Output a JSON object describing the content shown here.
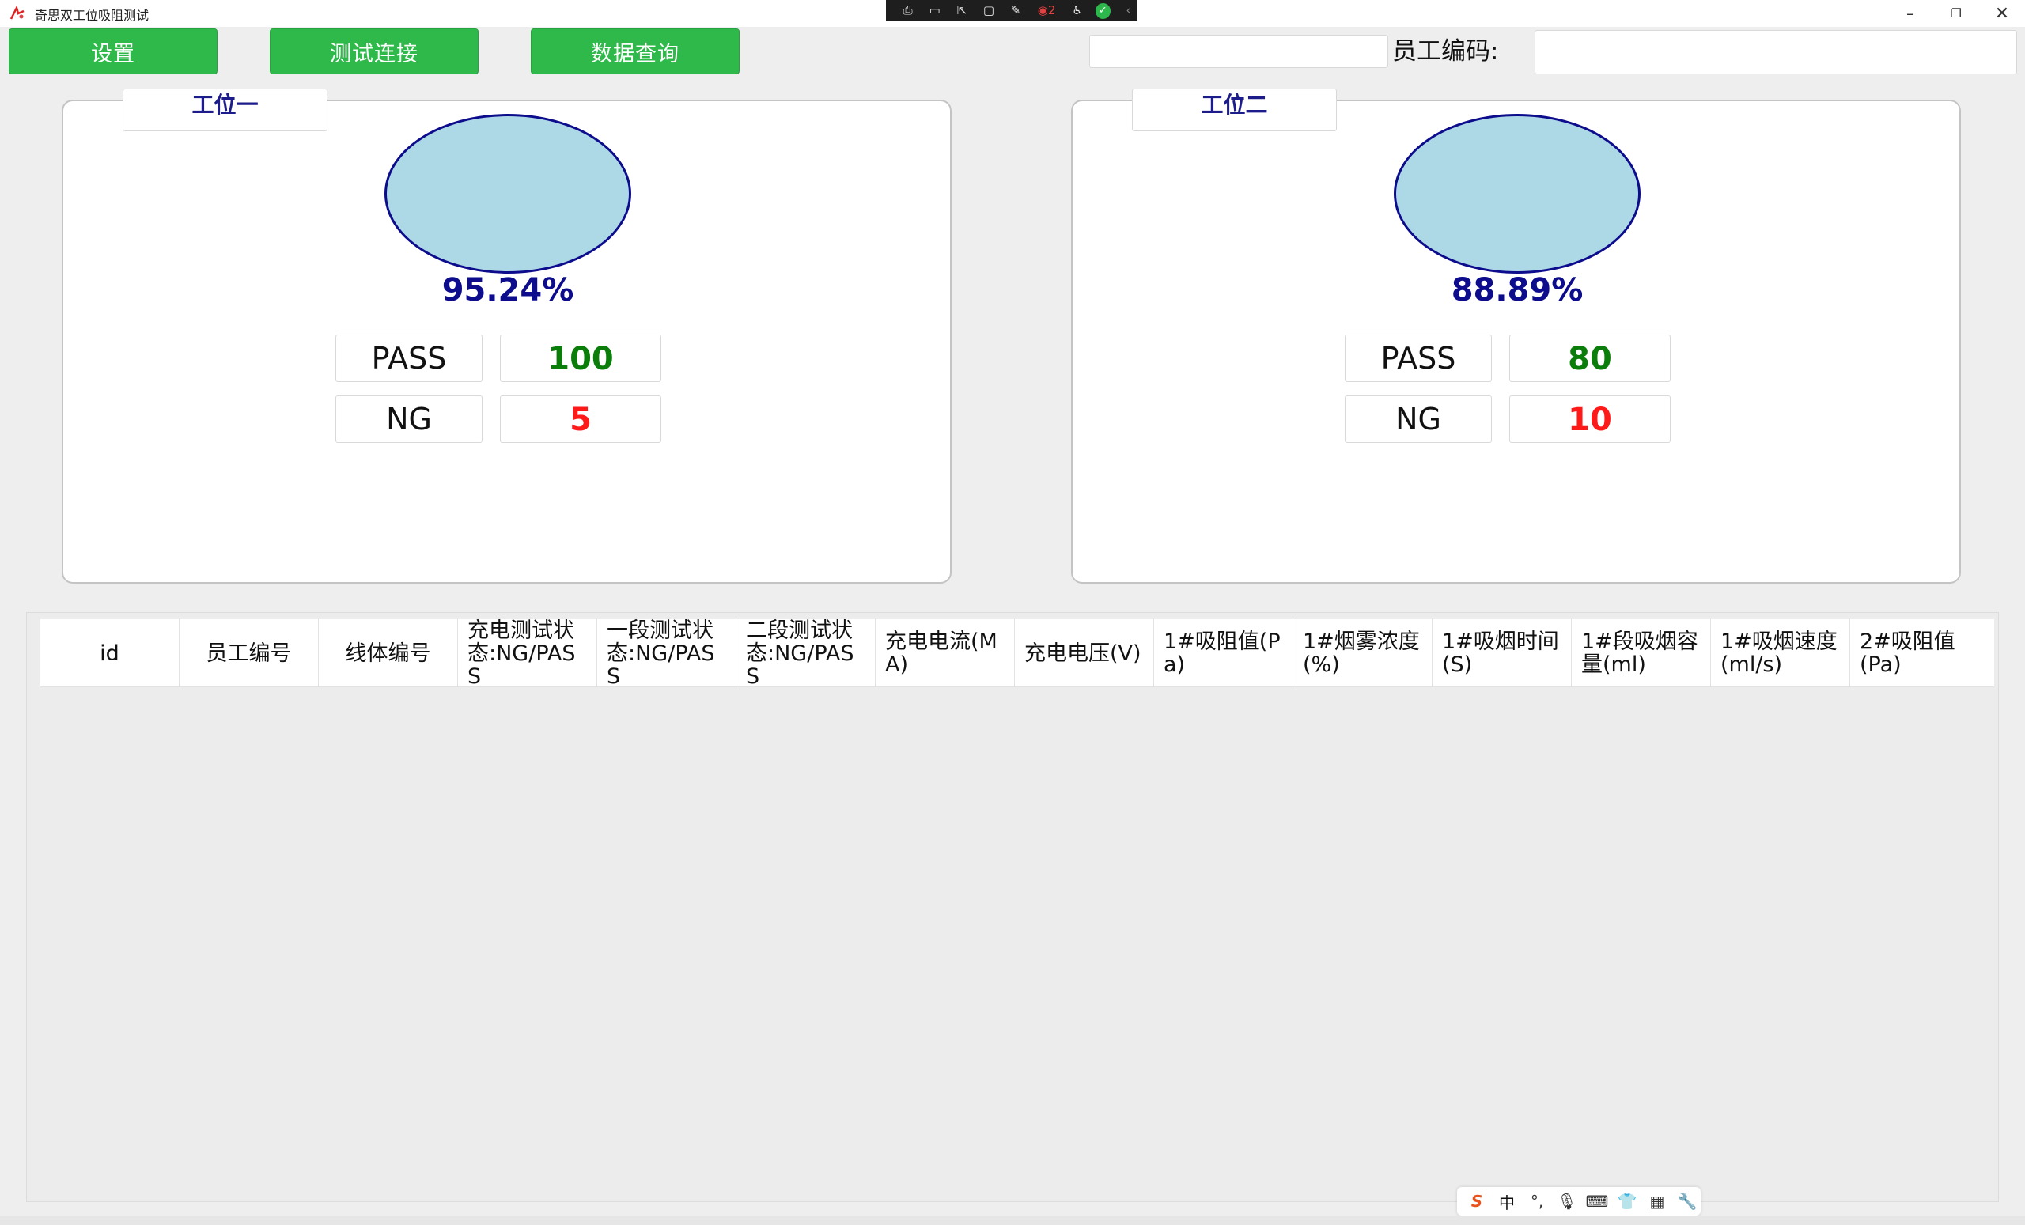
{
  "window": {
    "title": "奇思双工位吸阻测试",
    "minimize": "–",
    "maximize": "❐",
    "close": "✕"
  },
  "recorder_toolbar": {
    "icons": [
      "screenshot-icon",
      "video-icon",
      "pointer-icon",
      "frame-icon",
      "draw-icon",
      "record-badge-icon",
      "accessibility-icon",
      "check-icon",
      "collapse-icon"
    ],
    "badge_count": "2"
  },
  "toolbar": {
    "settings_label": "设置",
    "test_connection_label": "测试连接",
    "data_query_label": "数据查询",
    "search_value": "",
    "employee_code_label": "员工编码:",
    "employee_code_value": ""
  },
  "stations": [
    {
      "name": "工位一",
      "yield": "95.24%",
      "pass_label": "PASS",
      "pass_count": "100",
      "ng_label": "NG",
      "ng_count": "5"
    },
    {
      "name": "工位二",
      "yield": "88.89%",
      "pass_label": "PASS",
      "pass_count": "80",
      "ng_label": "NG",
      "ng_count": "10"
    }
  ],
  "table": {
    "columns": [
      "id",
      "员工编号",
      "线体编号",
      "充电测试状态:NG/PASS",
      "一段测试状态:NG/PASS",
      "二段测试状态:NG/PASS",
      "充电电流(MA)",
      "充电电压(V)",
      "1#吸阻值(Pa)",
      "1#烟雾浓度(%)",
      "1#吸烟时间(S)",
      "1#段吸烟容量(ml)",
      "1#吸烟速度(ml/s)",
      "2#吸阻值(Pa)"
    ],
    "rows": []
  },
  "ime": {
    "logo": "S",
    "mode": "中",
    "punct": "°,",
    "mic": "🎙",
    "keyboard": "⌨",
    "skin": "👕",
    "grid": "▦",
    "tools": "🔧"
  },
  "colors": {
    "button_green": "#2fb94a",
    "circle_fill": "#add8e6",
    "circle_stroke": "#0c0c8c",
    "pass_color": "#0a7d0a",
    "ng_color": "#ff1a1a"
  }
}
